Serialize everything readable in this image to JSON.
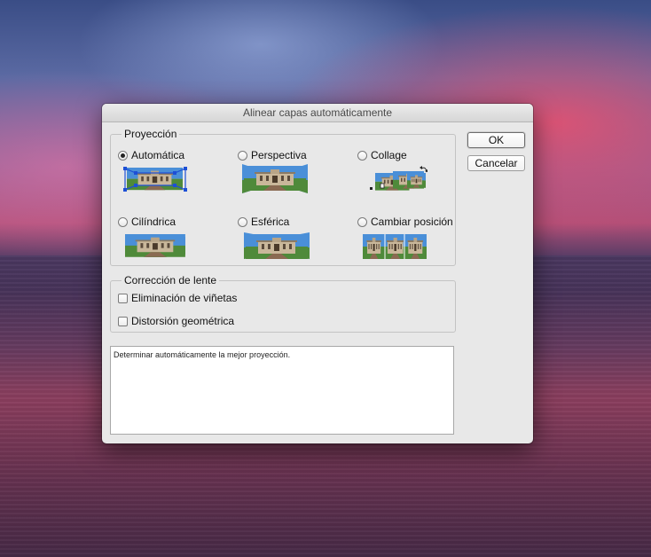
{
  "dialog": {
    "title": "Alinear capas automáticamente",
    "ok_label": "OK",
    "cancel_label": "Cancelar"
  },
  "projection": {
    "legend": "Proyección",
    "selected": "Automática",
    "options": [
      {
        "label": "Automática",
        "icon": "auto-projection-thumbnail"
      },
      {
        "label": "Perspectiva",
        "icon": "perspective-thumbnail"
      },
      {
        "label": "Collage",
        "icon": "collage-thumbnail"
      },
      {
        "label": "Cilíndrica",
        "icon": "cylindrical-thumbnail"
      },
      {
        "label": "Esférica",
        "icon": "spherical-thumbnail"
      },
      {
        "label": "Cambiar posición",
        "icon": "reposition-thumbnail"
      }
    ]
  },
  "lens": {
    "legend": "Corrección de lente",
    "options": [
      {
        "label": "Eliminación de viñetas",
        "checked": false
      },
      {
        "label": "Distorsión geométrica",
        "checked": false
      }
    ]
  },
  "description": "Determinar automáticamente la mejor proyección.",
  "colors": {
    "sky_blue": "#4a8fd8",
    "grass_green": "#4f8a3a",
    "building_beige": "#c9b79a",
    "selection_blue": "#1d4fd6"
  }
}
